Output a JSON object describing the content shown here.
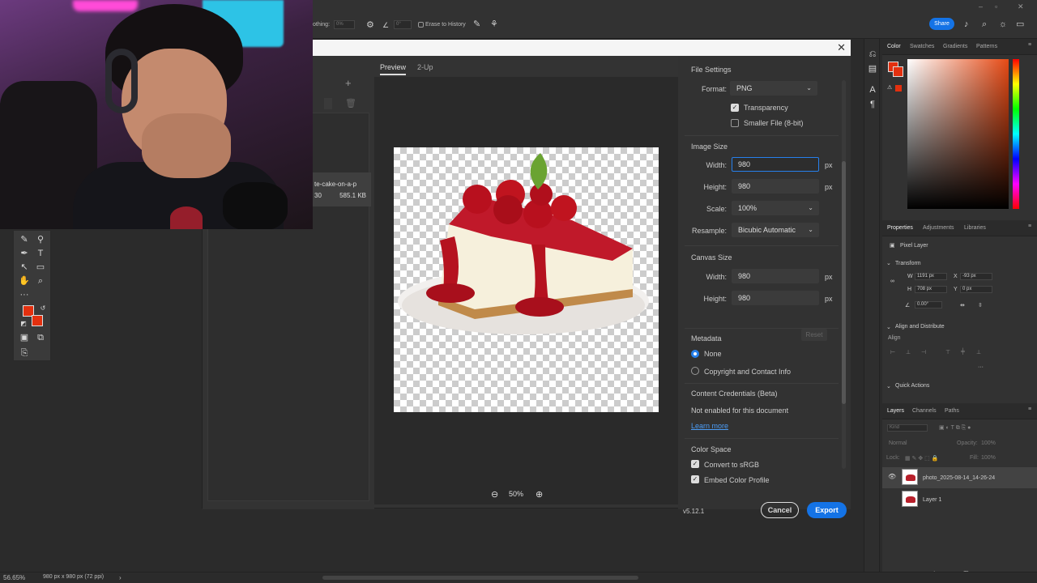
{
  "optbar": {
    "smoothing_label": "othing:",
    "smoothing_value": "0%",
    "angle_value": "0°",
    "erase_to_history": "Erase to History",
    "share_label": "Share"
  },
  "tools": {
    "icons": [
      "brush-icon",
      "eyedropper-icon",
      "pen-icon",
      "type-icon",
      "path-select-icon",
      "rectangle-icon",
      "hand-icon",
      "zoom-icon",
      "more-icon",
      "swap-colors-icon",
      "default-colors-icon",
      "quick-mask-icon",
      "screen-mode-icon",
      "artboard-icon"
    ]
  },
  "dialog": {
    "tabs": [
      {
        "label": "Preview"
      },
      {
        "label": "2-Up"
      }
    ],
    "file": {
      "name": "te-cake-on-a-p",
      "dim": "30",
      "size": "585.1 KB"
    },
    "zoom": "50%",
    "version": "v5.12.1",
    "file_settings": {
      "title": "File Settings",
      "format_label": "Format:",
      "format_value": "PNG",
      "transparency": "Transparency",
      "smaller_file": "Smaller File (8-bit)"
    },
    "image_size": {
      "title": "Image Size",
      "width_label": "Width:",
      "width_value": "980",
      "height_label": "Height:",
      "height_value": "980",
      "scale_label": "Scale:",
      "scale_value": "100%",
      "resample_label": "Resample:",
      "resample_value": "Bicubic Automatic",
      "unit": "px"
    },
    "canvas_size": {
      "title": "Canvas Size",
      "width_label": "Width:",
      "width_value": "980",
      "height_label": "Height:",
      "height_value": "980",
      "unit": "px",
      "reset": "Reset"
    },
    "metadata": {
      "title": "Metadata",
      "none": "None",
      "copyright": "Copyright and Contact Info"
    },
    "content_credentials": {
      "title": "Content Credentials (Beta)",
      "status": "Not enabled for this document",
      "learn_more": "Learn more"
    },
    "color_space": {
      "title": "Color Space",
      "convert": "Convert to sRGB",
      "embed": "Embed Color Profile"
    },
    "cancel": "Cancel",
    "export": "Export"
  },
  "color_panel": {
    "tabs": [
      {
        "label": "Color"
      },
      {
        "label": "Swatches"
      },
      {
        "label": "Gradients"
      },
      {
        "label": "Patterns"
      }
    ],
    "accent": "#e3300f"
  },
  "properties": {
    "tabs": [
      {
        "label": "Properties"
      },
      {
        "label": "Adjustments"
      },
      {
        "label": "Libraries"
      }
    ],
    "kind": "Pixel Layer",
    "transform": "Transform",
    "w_label": "W",
    "w_value": "1191 px",
    "x_label": "X",
    "x_value": "-93 px",
    "h_label": "H",
    "h_value": "708 px",
    "y_label": "Y",
    "y_value": "0 px",
    "angle": "0.00°",
    "align_distribute": "Align and Distribute",
    "align": "Align",
    "quick_actions": "Quick Actions"
  },
  "layers": {
    "tabs": [
      {
        "label": "Layers"
      },
      {
        "label": "Channels"
      },
      {
        "label": "Paths"
      }
    ],
    "search_placeholder": "Kind",
    "blend": "Normal",
    "opacity_label": "Opacity:",
    "opacity_value": "100%",
    "lock_label": "Lock:",
    "fill_label": "Fill:",
    "fill_value": "100%",
    "items": [
      {
        "name": "photo_2025-08-14_14-26-24"
      },
      {
        "name": "Layer 1"
      }
    ]
  },
  "status": {
    "zoom": "56.65%",
    "doc_info": "980 px x 980 px (72 ppi)"
  }
}
